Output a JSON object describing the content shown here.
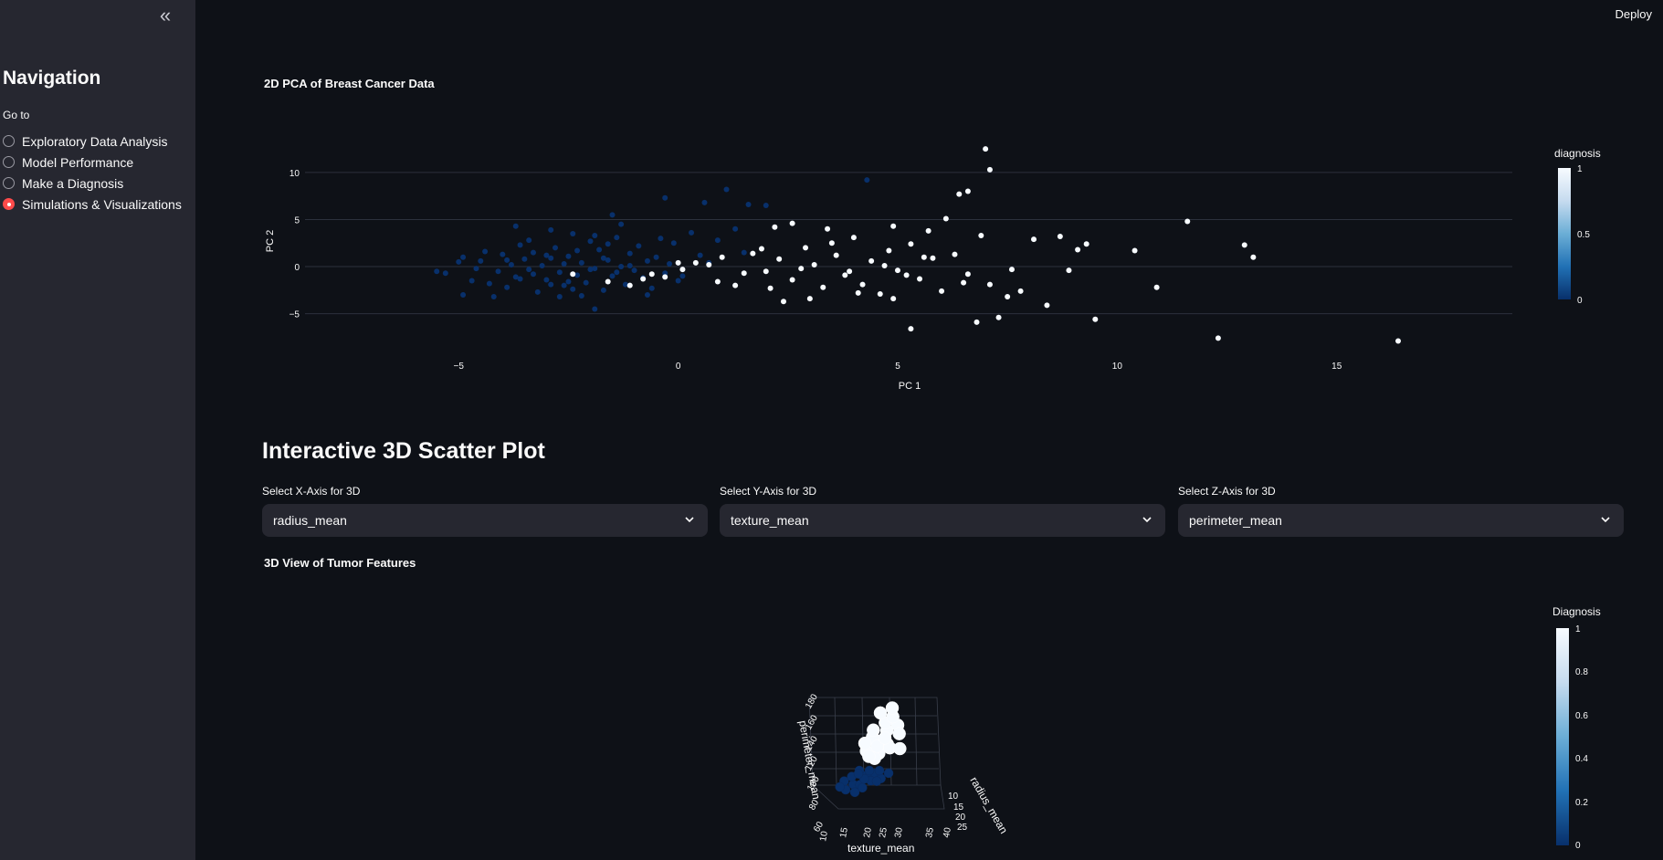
{
  "app": {
    "deploy_label": "Deploy"
  },
  "sidebar": {
    "title": "Navigation",
    "radio_label": "Go to",
    "options": [
      {
        "label": "Exploratory Data Analysis",
        "selected": false
      },
      {
        "label": "Model Performance",
        "selected": false
      },
      {
        "label": "Make a Diagnosis",
        "selected": false
      },
      {
        "label": "Simulations & Visualizations",
        "selected": true
      }
    ],
    "collapse_icon": "chevrons-left-icon"
  },
  "pca_chart": {
    "title": "2D PCA of Breast Cancer Data",
    "xlabel": "PC 1",
    "ylabel": "PC 2",
    "xticks": [
      "−5",
      "0",
      "5",
      "10",
      "15"
    ],
    "yticks": [
      "10",
      "5",
      "0",
      "−5"
    ],
    "colorbar_title": "diagnosis",
    "colorbar_ticks": [
      "1",
      "0.5",
      "0"
    ]
  },
  "section3d": {
    "title": "Interactive 3D Scatter Plot",
    "selects": [
      {
        "label": "Select X-Axis for 3D",
        "value": "radius_mean"
      },
      {
        "label": "Select Y-Axis for 3D",
        "value": "texture_mean"
      },
      {
        "label": "Select Z-Axis for 3D",
        "value": "perimeter_mean"
      }
    ]
  },
  "scatter3d": {
    "title": "3D View of Tumor Features",
    "colorbar_title": "Diagnosis",
    "colorbar_ticks": [
      "1",
      "0.8",
      "0.6",
      "0.4",
      "0.2",
      "0"
    ],
    "x_axis_label": "radius_mean",
    "y_axis_label": "texture_mean",
    "z_axis_label": "perimeter_mean",
    "x_ticks": [
      "10",
      "15",
      "20",
      "25"
    ],
    "y_ticks": [
      "10",
      "15",
      "20",
      "25",
      "30",
      "35",
      "40"
    ],
    "z_ticks": [
      "180",
      "160",
      "140",
      "120",
      "100",
      "80",
      "60"
    ]
  },
  "chart_data": [
    {
      "type": "scatter",
      "title": "2D PCA of Breast Cancer Data",
      "xlabel": "PC 1",
      "ylabel": "PC 2",
      "xlim": [
        -8.5,
        19
      ],
      "ylim": [
        -9.5,
        13
      ],
      "color_legend": "diagnosis",
      "colors": {
        "0": "#08306b",
        "1": "#f7fbff"
      },
      "series": [
        {
          "name": "0",
          "points": [
            [
              -5.5,
              -0.5
            ],
            [
              -5.3,
              -0.7
            ],
            [
              -5.0,
              0.5
            ],
            [
              -4.9,
              1.0
            ],
            [
              -4.6,
              -0.2
            ],
            [
              -4.5,
              0.6
            ],
            [
              -4.3,
              -1.8
            ],
            [
              -4.2,
              -3.2
            ],
            [
              -4.1,
              -0.5
            ],
            [
              -4.0,
              1.3
            ],
            [
              -3.9,
              -2.2
            ],
            [
              -3.8,
              0.2
            ],
            [
              -3.7,
              -1.1
            ],
            [
              -3.6,
              2.3
            ],
            [
              -3.5,
              0.8
            ],
            [
              -3.4,
              -0.3
            ],
            [
              -3.3,
              1.5
            ],
            [
              -3.2,
              -2.7
            ],
            [
              -3.1,
              0.1
            ],
            [
              -3.0,
              -1.4
            ],
            [
              -2.9,
              0.9
            ],
            [
              -2.8,
              2.0
            ],
            [
              -2.7,
              -0.6
            ],
            [
              -2.6,
              -2.0
            ],
            [
              -2.5,
              1.1
            ],
            [
              -2.4,
              3.5
            ],
            [
              -2.3,
              -0.9
            ],
            [
              -2.2,
              0.4
            ],
            [
              -2.1,
              -1.7
            ],
            [
              -2.0,
              2.7
            ],
            [
              -1.9,
              -0.2
            ],
            [
              -1.8,
              1.8
            ],
            [
              -1.7,
              -2.5
            ],
            [
              -1.6,
              0.7
            ],
            [
              -1.5,
              -1.0
            ],
            [
              -1.4,
              3.1
            ],
            [
              -1.3,
              0.0
            ],
            [
              -1.2,
              -1.9
            ],
            [
              -1.1,
              1.4
            ],
            [
              -1.0,
              -0.4
            ],
            [
              -0.9,
              2.2
            ],
            [
              -0.8,
              -1.2
            ],
            [
              -0.7,
              0.6
            ],
            [
              -0.6,
              -2.3
            ],
            [
              -0.5,
              1.0
            ],
            [
              -0.4,
              3.0
            ],
            [
              -0.3,
              -0.7
            ],
            [
              -0.2,
              0.3
            ],
            [
              -0.1,
              2.5
            ],
            [
              0.0,
              -1.5
            ],
            [
              -3.9,
              0.7
            ],
            [
              -3.6,
              -1.3
            ],
            [
              -3.3,
              -0.8
            ],
            [
              -2.9,
              -1.9
            ],
            [
              -2.6,
              0.3
            ],
            [
              -2.3,
              1.7
            ],
            [
              -2.0,
              -0.3
            ],
            [
              -1.7,
              0.9
            ],
            [
              -1.4,
              -0.6
            ],
            [
              -1.1,
              0.1
            ],
            [
              -4.7,
              -1.5
            ],
            [
              -4.4,
              1.6
            ],
            [
              -2.2,
              -3.1
            ],
            [
              -1.5,
              5.5
            ],
            [
              -0.3,
              7.3
            ],
            [
              0.3,
              3.6
            ],
            [
              0.6,
              6.8
            ],
            [
              1.1,
              8.2
            ],
            [
              1.6,
              6.6
            ],
            [
              2.0,
              6.5
            ],
            [
              -3.7,
              4.3
            ],
            [
              -2.9,
              3.9
            ],
            [
              -1.3,
              4.5
            ],
            [
              0.5,
              1.2
            ],
            [
              0.9,
              2.8
            ],
            [
              1.3,
              4.0
            ],
            [
              -1.9,
              -4.5
            ],
            [
              -2.4,
              -2.4
            ],
            [
              -4.9,
              -3.0
            ],
            [
              1.5,
              1.5
            ],
            [
              -3.4,
              2.8
            ],
            [
              -2.7,
              -3.2
            ],
            [
              -1.9,
              3.3
            ],
            [
              -0.7,
              -3.0
            ],
            [
              0.1,
              -1.0
            ],
            [
              0.7,
              0.4
            ],
            [
              4.3,
              9.2
            ],
            [
              -3.0,
              1.2
            ],
            [
              -2.5,
              -1.6
            ],
            [
              -1.6,
              2.4
            ]
          ]
        },
        {
          "name": "1",
          "points": [
            [
              -2.4,
              -0.8
            ],
            [
              -1.6,
              -1.6
            ],
            [
              -1.1,
              -2.0
            ],
            [
              -0.6,
              -0.8
            ],
            [
              -0.3,
              -1.1
            ],
            [
              0.1,
              -0.3
            ],
            [
              0.4,
              0.4
            ],
            [
              0.7,
              0.2
            ],
            [
              1.0,
              1.0
            ],
            [
              1.3,
              -2.0
            ],
            [
              1.7,
              1.4
            ],
            [
              2.0,
              -0.5
            ],
            [
              2.3,
              0.8
            ],
            [
              2.6,
              -1.4
            ],
            [
              2.9,
              2.0
            ],
            [
              3.1,
              0.2
            ],
            [
              3.3,
              -2.2
            ],
            [
              3.6,
              1.2
            ],
            [
              3.8,
              -0.9
            ],
            [
              4.0,
              3.1
            ],
            [
              4.2,
              -1.9
            ],
            [
              4.4,
              0.6
            ],
            [
              4.6,
              -2.9
            ],
            [
              4.8,
              1.7
            ],
            [
              5.0,
              -0.4
            ],
            [
              5.3,
              2.4
            ],
            [
              5.5,
              -1.3
            ],
            [
              5.8,
              0.9
            ],
            [
              6.0,
              -2.6
            ],
            [
              6.3,
              1.3
            ],
            [
              6.6,
              -0.8
            ],
            [
              6.9,
              3.3
            ],
            [
              7.1,
              -1.9
            ],
            [
              7.3,
              -5.4
            ],
            [
              7.5,
              -3.2
            ],
            [
              7.8,
              -2.6
            ],
            [
              8.1,
              2.9
            ],
            [
              8.4,
              -4.1
            ],
            [
              8.7,
              3.2
            ],
            [
              9.1,
              1.8
            ],
            [
              9.5,
              -5.6
            ],
            [
              10.4,
              1.7
            ],
            [
              10.9,
              -2.2
            ],
            [
              11.6,
              4.8
            ],
            [
              12.3,
              -7.6
            ],
            [
              12.9,
              2.3
            ],
            [
              13.1,
              1.0
            ],
            [
              16.4,
              -7.9
            ],
            [
              6.4,
              7.7
            ],
            [
              7.0,
              12.5
            ],
            [
              7.1,
              10.3
            ],
            [
              6.6,
              8.0
            ],
            [
              6.1,
              5.1
            ],
            [
              5.7,
              3.8
            ],
            [
              4.9,
              4.3
            ],
            [
              3.4,
              4.0
            ],
            [
              2.6,
              4.6
            ],
            [
              2.2,
              4.2
            ],
            [
              5.3,
              -6.6
            ],
            [
              6.8,
              -5.9
            ],
            [
              3.0,
              -3.4
            ],
            [
              2.1,
              -2.3
            ],
            [
              1.5,
              -0.7
            ],
            [
              0.9,
              -1.6
            ],
            [
              0.0,
              0.4
            ],
            [
              -0.8,
              -1.3
            ],
            [
              1.9,
              1.9
            ],
            [
              2.8,
              -0.2
            ],
            [
              3.9,
              -0.5
            ],
            [
              4.7,
              0.1
            ],
            [
              5.6,
              1.0
            ],
            [
              6.5,
              -1.7
            ],
            [
              7.6,
              -0.3
            ],
            [
              8.9,
              -0.4
            ],
            [
              9.3,
              2.4
            ],
            [
              3.5,
              2.5
            ],
            [
              4.1,
              -2.8
            ],
            [
              4.9,
              -3.4
            ],
            [
              5.2,
              -0.9
            ],
            [
              2.4,
              -3.7
            ]
          ]
        }
      ]
    },
    {
      "type": "scatter",
      "title": "3D View of Tumor Features",
      "xlabel": "radius_mean",
      "ylabel": "texture_mean",
      "zlabel": "perimeter_mean",
      "color_legend": "Diagnosis",
      "colorscale_range": [
        0,
        1
      ],
      "colors": {
        "0": "#08306b",
        "1": "#f7fbff"
      },
      "series": [
        {
          "name": "0",
          "points": [
            [
              12,
              15,
              78
            ],
            [
              11,
              18,
              72
            ],
            [
              13,
              20,
              85
            ],
            [
              12,
              22,
              80
            ],
            [
              10,
              16,
              65
            ],
            [
              13,
              24,
              86
            ],
            [
              11,
              20,
              71
            ],
            [
              14,
              19,
              92
            ],
            [
              12,
              26,
              78
            ],
            [
              13,
              17,
              84
            ],
            [
              10,
              21,
              66
            ],
            [
              12,
              23,
              76
            ],
            [
              14,
              25,
              90
            ],
            [
              11,
              14,
              70
            ],
            [
              13,
              28,
              85
            ],
            [
              9,
              19,
              60
            ],
            [
              12,
              21,
              79
            ],
            [
              14,
              22,
              91
            ],
            [
              11,
              25,
              74
            ],
            [
              13,
              19,
              87
            ]
          ]
        },
        {
          "name": "1",
          "points": [
            [
              18,
              20,
              120
            ],
            [
              20,
              22,
              135
            ],
            [
              17,
              24,
              115
            ],
            [
              19,
              26,
              128
            ],
            [
              21,
              21,
              140
            ],
            [
              22,
              25,
              148
            ],
            [
              16,
              23,
              108
            ],
            [
              23,
              28,
              155
            ],
            [
              18,
              27,
              122
            ],
            [
              20,
              19,
              132
            ],
            [
              24,
              24,
              160
            ],
            [
              17,
              21,
              112
            ],
            [
              25,
              26,
              168
            ],
            [
              19,
              23,
              126
            ],
            [
              21,
              29,
              142
            ],
            [
              26,
              22,
              175
            ],
            [
              28,
              25,
              182
            ],
            [
              18,
              30,
              120
            ],
            [
              20,
              25,
              137
            ],
            [
              22,
              21,
              150
            ]
          ]
        }
      ]
    }
  ]
}
